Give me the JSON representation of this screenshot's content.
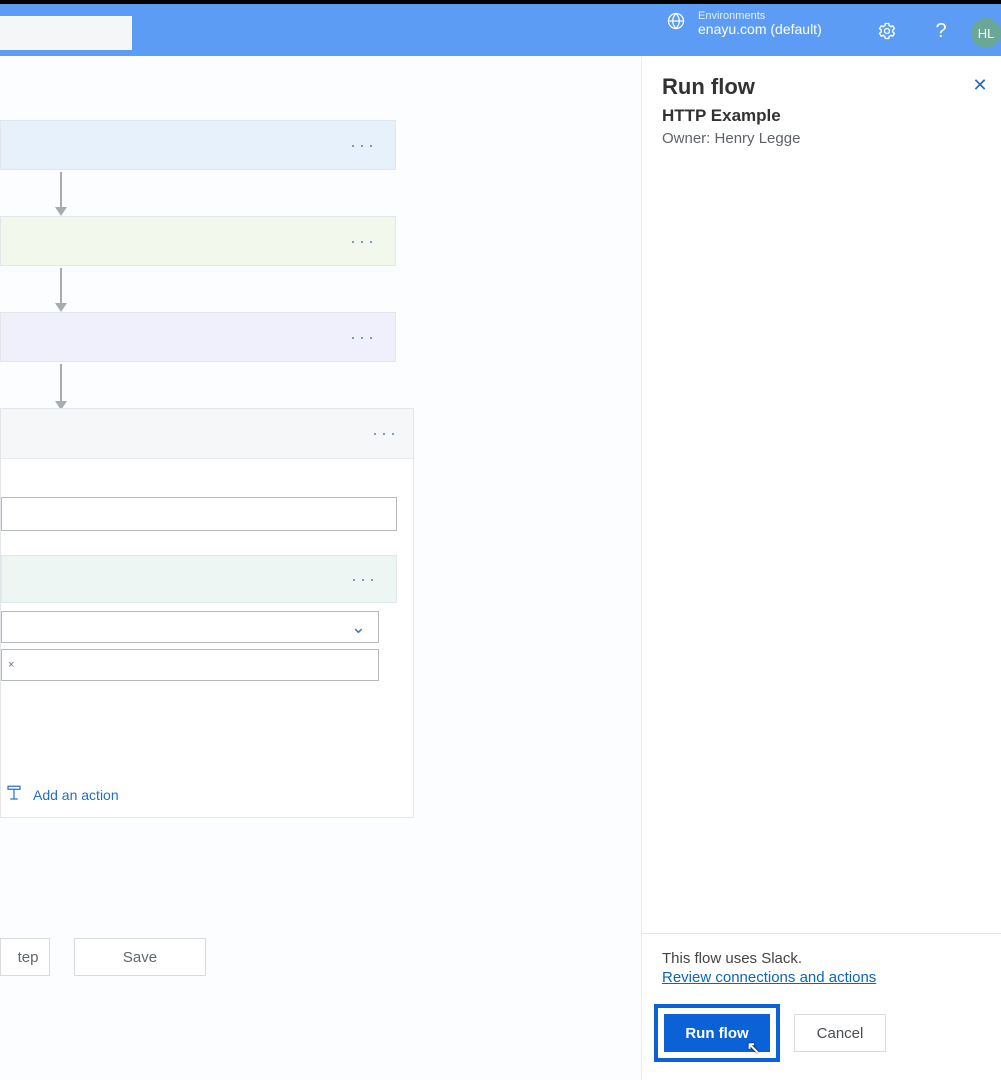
{
  "colors": {
    "header_bg": "#5c9cf5",
    "primary": "#0b61d6",
    "link": "#0a66c2"
  },
  "header": {
    "environments_label": "Environments",
    "environment_value": "enayu.com (default)",
    "avatar_initials": "HL"
  },
  "flow": {
    "add_action_label": "Add an action",
    "bottom_step_label": "tep",
    "bottom_save_label": "Save",
    "chip_close": "×"
  },
  "panel": {
    "title": "Run flow",
    "subtitle": "HTTP Example",
    "owner_line": "Owner: Henry Legge",
    "info_text": "This flow uses Slack.",
    "review_link": "Review connections and actions",
    "run_label": "Run flow",
    "cancel_label": "Cancel",
    "close_glyph": "✕"
  }
}
